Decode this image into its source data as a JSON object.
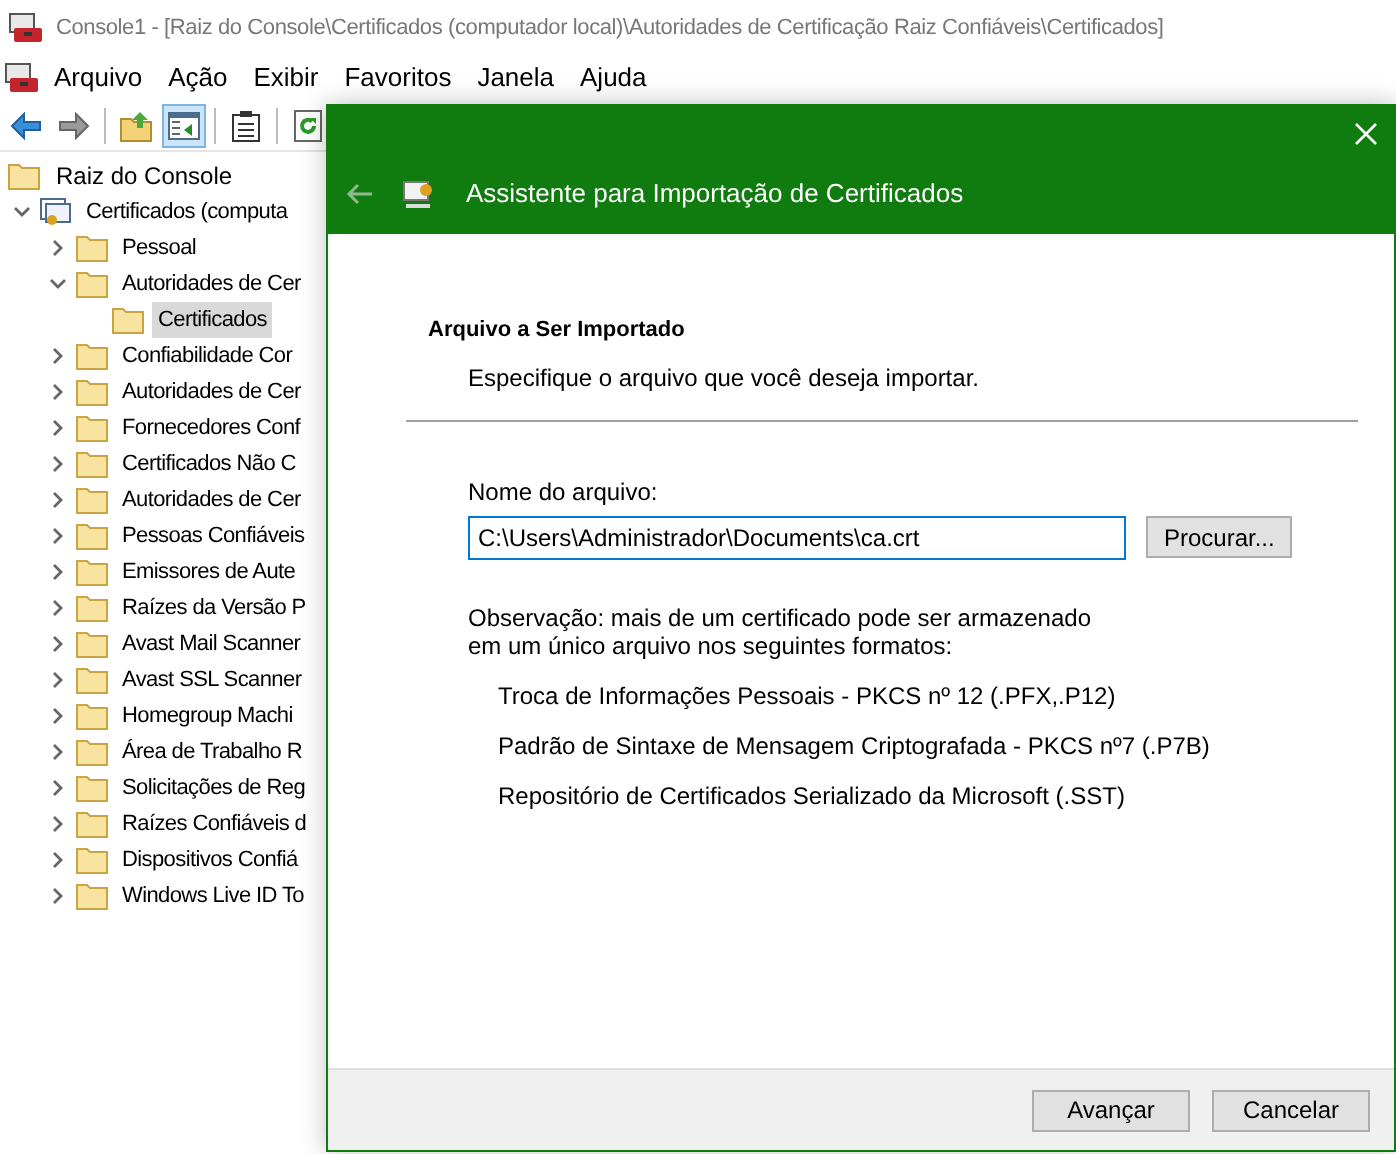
{
  "window": {
    "title": "Console1 - [Raiz do Console\\Certificados (computador local)\\Autoridades de Certificação Raiz Confiáveis\\Certificados]"
  },
  "menu": [
    "Arquivo",
    "Ação",
    "Exibir",
    "Favoritos",
    "Janela",
    "Ajuda"
  ],
  "toolbar": [
    {
      "kind": "back",
      "pressed": false
    },
    {
      "kind": "forward",
      "pressed": false
    },
    {
      "kind": "up",
      "pressed": false
    },
    {
      "kind": "tree",
      "pressed": true
    },
    {
      "kind": "export",
      "pressed": false
    },
    {
      "kind": "refresh",
      "pressed": false
    }
  ],
  "tree": {
    "root": {
      "label": "Raiz do Console",
      "children": [
        {
          "label": "Certificados (computa",
          "kind": "store",
          "expanded": true,
          "selected": false,
          "children": [
            {
              "label": "Pessoal",
              "expanded": false,
              "selected": false
            },
            {
              "label": "Autoridades de Cer",
              "expanded": true,
              "selected": false,
              "children": [
                {
                  "label": "Certificados",
                  "selected": true
                }
              ]
            },
            {
              "label": "Confiabilidade Cor",
              "expanded": false,
              "selected": false
            },
            {
              "label": "Autoridades de Cer",
              "expanded": false,
              "selected": false
            },
            {
              "label": "Fornecedores Conf",
              "expanded": false,
              "selected": false
            },
            {
              "label": "Certificados Não C",
              "expanded": false,
              "selected": false
            },
            {
              "label": "Autoridades de Cer",
              "expanded": false,
              "selected": false
            },
            {
              "label": "Pessoas Confiáveis",
              "expanded": false,
              "selected": false
            },
            {
              "label": "Emissores de Aute",
              "expanded": false,
              "selected": false
            },
            {
              "label": "Raízes da Versão P",
              "expanded": false,
              "selected": false
            },
            {
              "label": "Avast Mail Scanner",
              "expanded": false,
              "selected": false
            },
            {
              "label": "Avast SSL Scanner",
              "expanded": false,
              "selected": false
            },
            {
              "label": "Homegroup Machi",
              "expanded": false,
              "selected": false
            },
            {
              "label": "Área de Trabalho R",
              "expanded": false,
              "selected": false
            },
            {
              "label": "Solicitações de Reg",
              "expanded": false,
              "selected": false
            },
            {
              "label": "Raízes Confiáveis d",
              "expanded": false,
              "selected": false
            },
            {
              "label": "Dispositivos Confiá",
              "expanded": false,
              "selected": false
            },
            {
              "label": "Windows Live ID To",
              "expanded": false,
              "selected": false
            }
          ]
        }
      ]
    }
  },
  "dialog": {
    "title": "Assistente para Importação de Certificados",
    "back_disabled": true,
    "heading": "Arquivo a Ser Importado",
    "subheading": "Especifique o arquivo que você deseja importar.",
    "file_label": "Nome do arquivo:",
    "file_value": "C:\\Users\\Administrador\\Documents\\ca.crt",
    "browse": "Procurar...",
    "note": "Observação: mais de um certificado pode ser armazenado em um único arquivo nos seguintes formatos:",
    "formats": [
      "Troca de Informações Pessoais - PKCS nº 12 (.PFX,.P12)",
      "Padrão de Sintaxe de Mensagem Criptografada - PKCS nº7 (.P7B)",
      "Repositório de Certificados Serializado da Microsoft (.SST)"
    ],
    "buttons": [
      "Avançar",
      "Cancelar"
    ]
  }
}
